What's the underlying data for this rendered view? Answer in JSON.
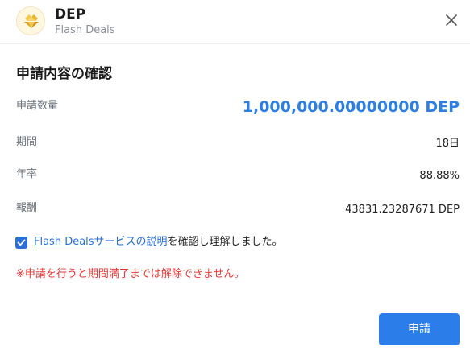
{
  "header": {
    "token_name": "DEP",
    "subtitle": "Flash Deals",
    "logo_icon": "dep-logo-icon",
    "close_icon": "close-icon"
  },
  "title": "申請内容の確認",
  "rows": [
    {
      "label": "申請数量",
      "value": "1,000,000.00000000 DEP"
    },
    {
      "label": "期間",
      "value": "18日"
    },
    {
      "label": "年率",
      "value": "88.88%"
    },
    {
      "label": "報酬",
      "value": "43831.23287671 DEP"
    }
  ],
  "agreement": {
    "checked": true,
    "link_text": "Flash Dealsサービスの説明",
    "suffix_text": "を確認し理解しました。"
  },
  "warning": "※申請を行うと期間満了までは解除できません。",
  "submit_label": "申請",
  "colors": {
    "accent": "#2b7de9",
    "highlight_value": "#2f7fe0",
    "warning": "#e53535",
    "logo_gold": "#e8b730"
  }
}
